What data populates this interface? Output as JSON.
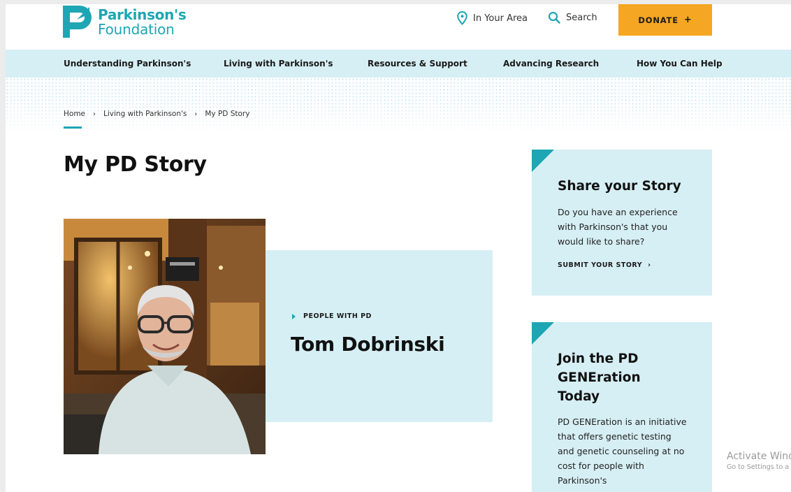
{
  "logo": {
    "line1": "Parkinson's",
    "line2": "Foundation"
  },
  "utility": {
    "area_label": "In Your Area",
    "search_label": "Search",
    "donate_label": "DONATE",
    "donate_plus": "+"
  },
  "nav": {
    "items": [
      {
        "label": "Understanding Parkinson's"
      },
      {
        "label": "Living with Parkinson's"
      },
      {
        "label": "Resources & Support"
      },
      {
        "label": "Advancing Research"
      },
      {
        "label": "How You Can Help"
      }
    ]
  },
  "breadcrumb": {
    "items": [
      "Home",
      "Living with Parkinson's",
      "My PD Story"
    ],
    "separator": "›"
  },
  "page_title": "My PD Story",
  "story": {
    "kicker": "PEOPLE WITH PD",
    "name": "Tom Dobrinski"
  },
  "sidebar": {
    "card1": {
      "title": "Share your Story",
      "body": "Do you have an experience with Parkinson's that you would like to share?",
      "link": "SUBMIT YOUR STORY",
      "link_chevron": "›"
    },
    "card2": {
      "title": "Join the PD GENEration Today",
      "body": "PD GENEration is an initiative that offers genetic testing and genetic counseling at no cost for people with Parkinson's"
    }
  },
  "watermark": {
    "line1": "Activate Wind",
    "line2": "Go to Settings to a"
  },
  "colors": {
    "teal": "#1ea6b4",
    "light_blue": "#d6eff4",
    "donate_orange": "#f5a623"
  }
}
